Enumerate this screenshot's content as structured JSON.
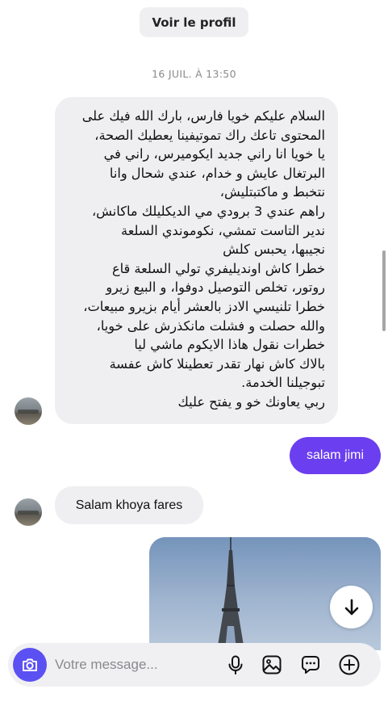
{
  "header": {
    "profile_button": "Voir le profil"
  },
  "conversation": {
    "timestamp": "16 JUIL. À 13:50",
    "incoming_message_1": {
      "lines": [
        "السلام عليكم خويا فارس، بارك الله فيك على",
        "المحتوى تاعك راك تموتيفينا يعطيك الصحة،",
        "يا خويا انا راني جديد ايكوميرس، راني في",
        "البرتغال عايش و خدام، عندي شحال وانا",
        "نتخبط و ماكتبتليش،",
        "راهم عندي 3 برودي مي الديكليلك ماكانش،",
        "ندير التاست تمشي، نكوموندي السلعة",
        "نجيبها، يحبس كلش",
        "خطرا كاش اونديليفري تولي السلعة قاع",
        "روتور، تخلص التوصيل دوفوا، و البيع زيرو",
        "خطرا تلنيسي الادز بالعشر أيام بزيرو مبيعات،",
        "والله حصلت و فشلت مانكذرش على خويا،",
        "خطرات نقول هاذا الايكوم ماشي ليا",
        "بالاك كاش نهار تقدر تعطينلا كاش عفسة",
        "تبوجيلنا الخدمة.",
        "ربي يعاونك خو و يفتح عليك"
      ]
    },
    "outgoing_message_1": "salam jimi",
    "incoming_message_2": "Salam khoya fares"
  },
  "composer": {
    "placeholder": "Votre message..."
  },
  "icons": {
    "avatar": "avatar-photo",
    "scroll": "arrow-down-icon",
    "camera": "camera-icon",
    "mic": "microphone-icon",
    "gallery": "image-icon",
    "sticker": "chat-bubble-icon",
    "add": "plus-circle-icon"
  },
  "colors": {
    "accent": "#6b3ef0",
    "camera_button": "#5b51f2",
    "bubble_incoming": "#efeff1"
  }
}
